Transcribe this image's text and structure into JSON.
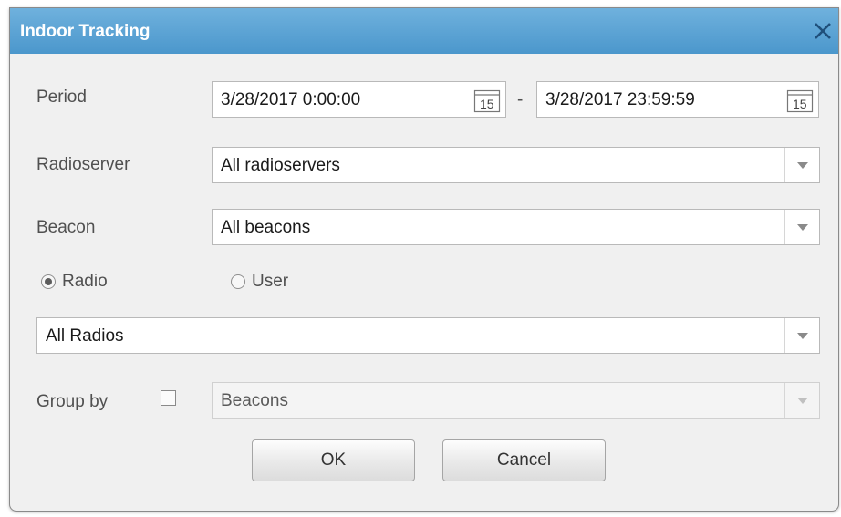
{
  "dialog": {
    "title": "Indoor Tracking"
  },
  "period": {
    "label": "Period",
    "start": "3/28/2017 0:00:00",
    "separator": "-",
    "end": "3/28/2017 23:59:59",
    "calendar_day": "15"
  },
  "radioserver": {
    "label": "Radioserver",
    "value": "All radioservers"
  },
  "beacon": {
    "label": "Beacon",
    "value": "All beacons"
  },
  "mode": {
    "radio_label": "Radio",
    "user_label": "User",
    "selected": "Radio"
  },
  "radios": {
    "value": "All Radios"
  },
  "group_by": {
    "label": "Group by",
    "checked": false,
    "value": "Beacons"
  },
  "buttons": {
    "ok": "OK",
    "cancel": "Cancel"
  },
  "colors": {
    "titlebar": "#5aa3d5",
    "dialog_bg": "#f0f0f0"
  },
  "icons": {
    "close": "close-icon",
    "calendar": "calendar-icon",
    "dropdown": "chevron-down-icon"
  }
}
